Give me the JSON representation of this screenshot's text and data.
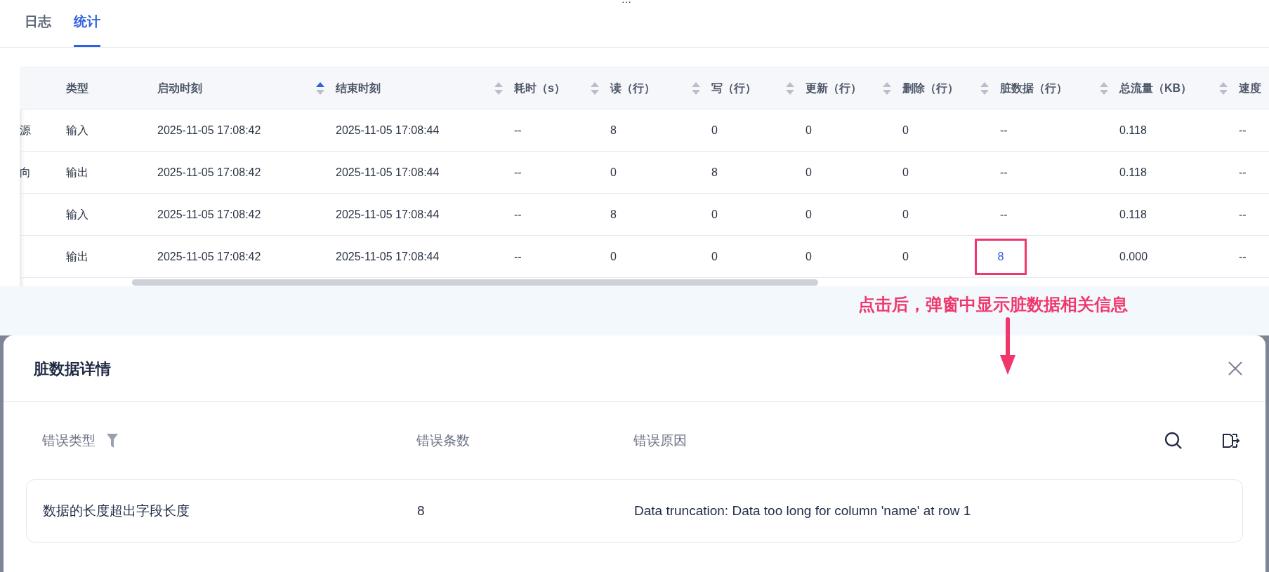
{
  "top_handle": "···",
  "tabs": [
    {
      "label": "日志",
      "selected": false
    },
    {
      "label": "统计",
      "selected": true
    }
  ],
  "table": {
    "columns": [
      {},
      {
        "label": "类型"
      },
      {
        "label": "启动时刻",
        "sorted_ascending": true
      },
      {
        "label": "结束时刻",
        "sorted_ascending": false
      },
      {
        "label": "耗时（s）",
        "sorted_ascending": false
      },
      {
        "label": "读（行）",
        "sorted_ascending": false
      },
      {
        "label": "写（行）",
        "sorted_ascending": false
      },
      {
        "label": "更新（行）",
        "sorted_ascending": false
      },
      {
        "label": "删除（行）",
        "sorted_ascending": false
      },
      {
        "label": "脏数据（行）",
        "sorted_ascending": false
      },
      {
        "label": "总流量（KB）",
        "sorted_ascending": false
      },
      {
        "label": "速度"
      }
    ],
    "rows": [
      {
        "cells": [
          "源",
          "输入",
          "2025-11-05 17:08:42",
          "2025-11-05 17:08:44",
          "--",
          "8",
          "0",
          "0",
          "0",
          "--",
          "0.118",
          "--"
        ]
      },
      {
        "cells": [
          "向",
          "输出",
          "2025-11-05 17:08:42",
          "2025-11-05 17:08:44",
          "--",
          "0",
          "8",
          "0",
          "0",
          "--",
          "0.118",
          "--"
        ]
      },
      {
        "cells": [
          null,
          "输入",
          "2025-11-05 17:08:42",
          "2025-11-05 17:08:44",
          "--",
          "8",
          "0",
          "0",
          "0",
          "--",
          "0.118",
          "--"
        ]
      },
      {
        "cells": [
          null,
          "输出",
          "2025-11-05 17:08:42",
          "2025-11-05 17:08:44",
          "--",
          "0",
          "0",
          "0",
          "0",
          {
            "text": "8",
            "kind": "link",
            "highlighted": true
          },
          "0.000",
          "--"
        ]
      }
    ]
  },
  "annotation": {
    "text": "点击后，弹窗中显示脏数据相关信息"
  },
  "dialog": {
    "title": "脏数据详情",
    "columns": [
      {
        "label": "错误类型",
        "filter": true
      },
      {
        "label": "错误条数"
      },
      {
        "label": "错误原因"
      }
    ],
    "rows": [
      {
        "cells": [
          "数据的长度超出字段长度",
          "8",
          "Data truncation: Data too long for column 'name' at row 1"
        ]
      }
    ]
  }
}
